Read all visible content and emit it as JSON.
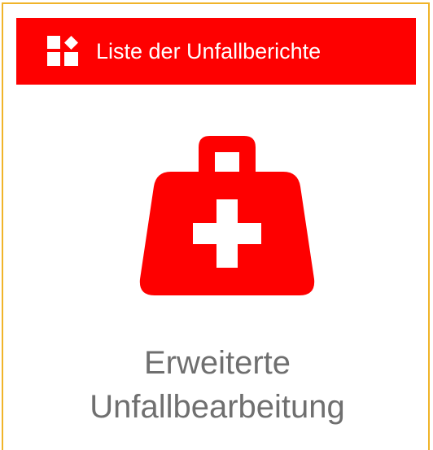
{
  "header": {
    "label": "Liste der Unfallberichte",
    "icon": "dashboard-grid-icon",
    "background_color": "#fe0000",
    "text_color": "#ffffff"
  },
  "tile": {
    "icon": "first-aid-kit-icon",
    "icon_color": "#fe0000",
    "title_line1": "Erweiterte",
    "title_line2": "Unfallbearbeitung",
    "title_color": "#6f6f6f",
    "border_color": "#f0b429"
  }
}
